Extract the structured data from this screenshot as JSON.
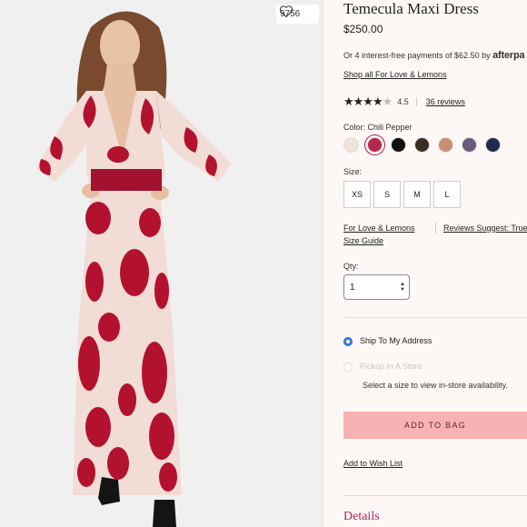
{
  "photo": {
    "favorite_count": "9756",
    "icon": "heart-icon"
  },
  "product": {
    "title": "Temecula Maxi Dress",
    "price": "$250.00",
    "afterpay_text": "Or 4 interest-free payments of $62.50 by",
    "afterpay_logo": "afterpa",
    "shop_all": "Shop all For Love & Lemons",
    "rating_value": "4.5",
    "rating_stars": 4.5,
    "reviews_link": "36 reviews",
    "color_label": "Color: Chili Pepper",
    "swatches": [
      {
        "name": "ivory",
        "color": "#efe3dc"
      },
      {
        "name": "chili-pepper",
        "color": "#b3274c",
        "selected": true
      },
      {
        "name": "black",
        "color": "#111111"
      },
      {
        "name": "black-gold",
        "color": "#3a2c20"
      },
      {
        "name": "nude",
        "color": "#c98d74"
      },
      {
        "name": "lavender-floral",
        "color": "#6c5a7a"
      },
      {
        "name": "navy",
        "color": "#1f2b4d"
      }
    ],
    "size_label": "Size:",
    "sizes": [
      "XS",
      "S",
      "M",
      "L"
    ],
    "brand_link": "For Love & Lemons",
    "reviews_suggest": "Reviews Suggest: True",
    "size_guide": "Size Guide",
    "qty_label": "Qty:",
    "qty_value": "1",
    "ship_option": "Ship To My Address",
    "pickup_option": "Pickup In A Store",
    "availability_note": "Select a size to view in-store availability.",
    "add_to_bag": "ADD TO BAG",
    "wish_list": "Add to Wish List",
    "details_heading": "Details"
  },
  "colors": {
    "accent_pink": "#f7b2b3",
    "details_color": "#b0245a",
    "radio_blue": "#3a7bd5"
  }
}
